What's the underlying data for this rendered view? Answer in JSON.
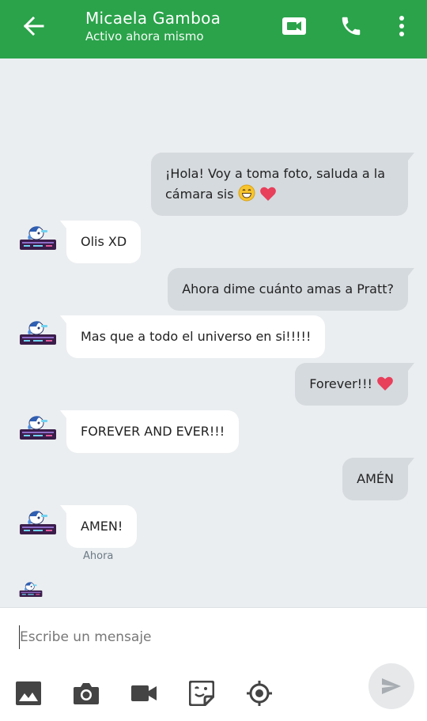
{
  "header": {
    "contact_name": "Micaela Gamboa",
    "status": "Activo ahora mismo",
    "background_color": "#2aa34a",
    "icons": [
      "arrow-back-icon",
      "video-call-icon",
      "phone-icon",
      "more-vert-icon"
    ]
  },
  "messages": [
    {
      "direction": "outgoing",
      "text": "¡Hola! Voy a toma foto, saluda a la cámara sis",
      "emojis": [
        "grinning-face-emoji",
        "red-heart-emoji"
      ]
    },
    {
      "direction": "incoming",
      "text": "Olis XD"
    },
    {
      "direction": "outgoing",
      "text": "Ahora dime cuánto amas a Pratt?"
    },
    {
      "direction": "incoming",
      "text": "Mas que a todo el universo en si!!!!!"
    },
    {
      "direction": "outgoing",
      "text": "Forever!!!",
      "emojis": [
        "red-heart-emoji"
      ]
    },
    {
      "direction": "incoming",
      "text": "FOREVER AND EVER!!!"
    },
    {
      "direction": "outgoing",
      "text": "AMÉN"
    },
    {
      "direction": "incoming",
      "text": "AMEN!",
      "timestamp": "Ahora"
    }
  ],
  "composer": {
    "placeholder": "Escribe un mensaje",
    "value": "",
    "tools": [
      "image-icon",
      "camera-icon",
      "video-icon",
      "sticker-icon",
      "location-icon"
    ],
    "send_icon": "send-icon"
  },
  "colors": {
    "outgoing_bubble": "#d5dade",
    "incoming_bubble": "#ffffff",
    "chat_background": "#ebeef0"
  }
}
